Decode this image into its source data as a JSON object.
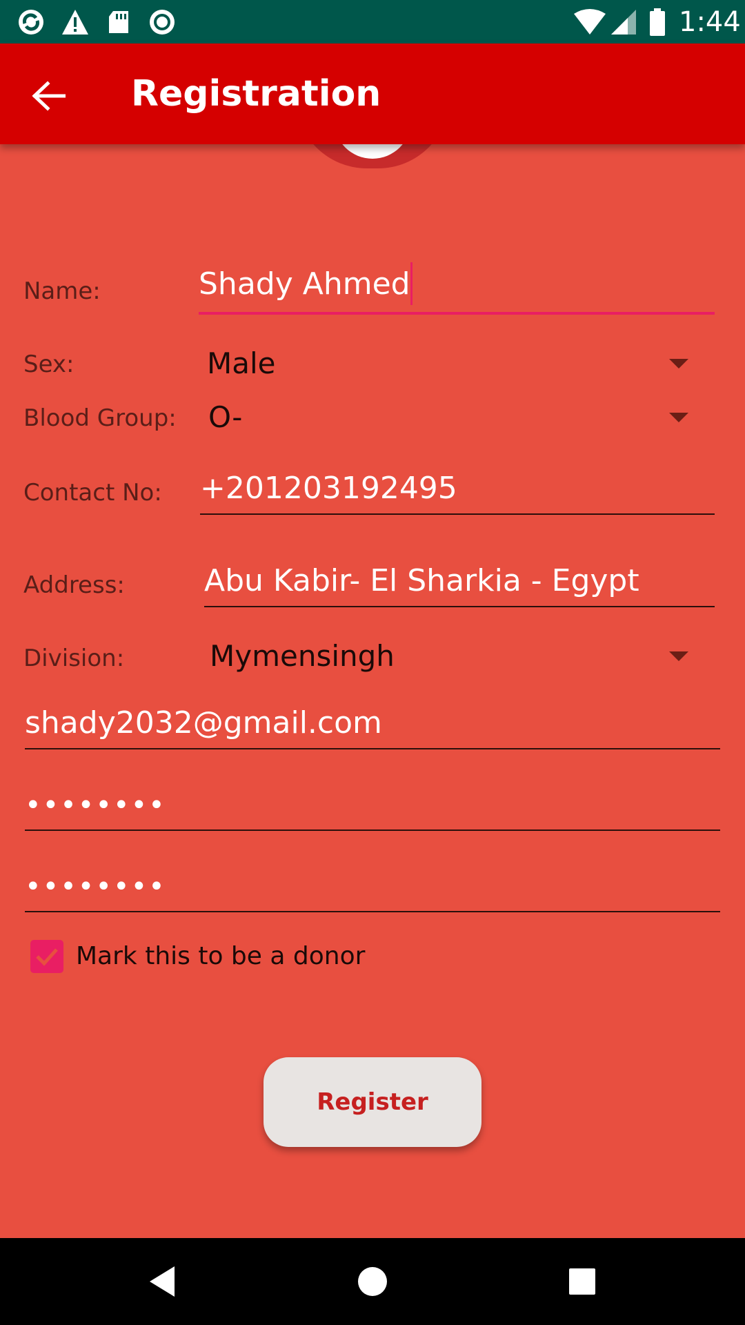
{
  "status_bar": {
    "time": "1:44",
    "left_icons": [
      "sync-icon",
      "warning-icon",
      "sd-card-icon",
      "record-icon"
    ],
    "right_icons": [
      "wifi-icon",
      "signal-icon",
      "battery-icon"
    ],
    "background": "#00574B"
  },
  "app_bar": {
    "title": "Registration",
    "back_icon": "arrow-left-icon",
    "background": "#D50000"
  },
  "form": {
    "name": {
      "label": "Name:",
      "value": "Shady Ahmed"
    },
    "sex": {
      "label": "Sex:",
      "value": "Male"
    },
    "blood_group": {
      "label": "Blood Group:",
      "value": "O-"
    },
    "contact": {
      "label": "Contact No:",
      "value": "+201203192495"
    },
    "address": {
      "label": "Address:",
      "value": "Abu Kabir- El Sharkia - Egypt"
    },
    "division": {
      "label": "Division:",
      "value": "Mymensingh"
    },
    "email": {
      "value": "shady2032@gmail.com"
    },
    "password": {
      "value": "••••••••"
    },
    "confirm_password": {
      "value": "••••••••"
    },
    "donor": {
      "label": "Mark this to be a donor",
      "checked": true
    },
    "register_label": "Register"
  },
  "colors": {
    "background": "#E84F40",
    "accent": "#E91E63",
    "button_text": "#C62020"
  },
  "nav_bar": {
    "icons": [
      "back-triangle-icon",
      "home-circle-icon",
      "recents-square-icon"
    ]
  }
}
